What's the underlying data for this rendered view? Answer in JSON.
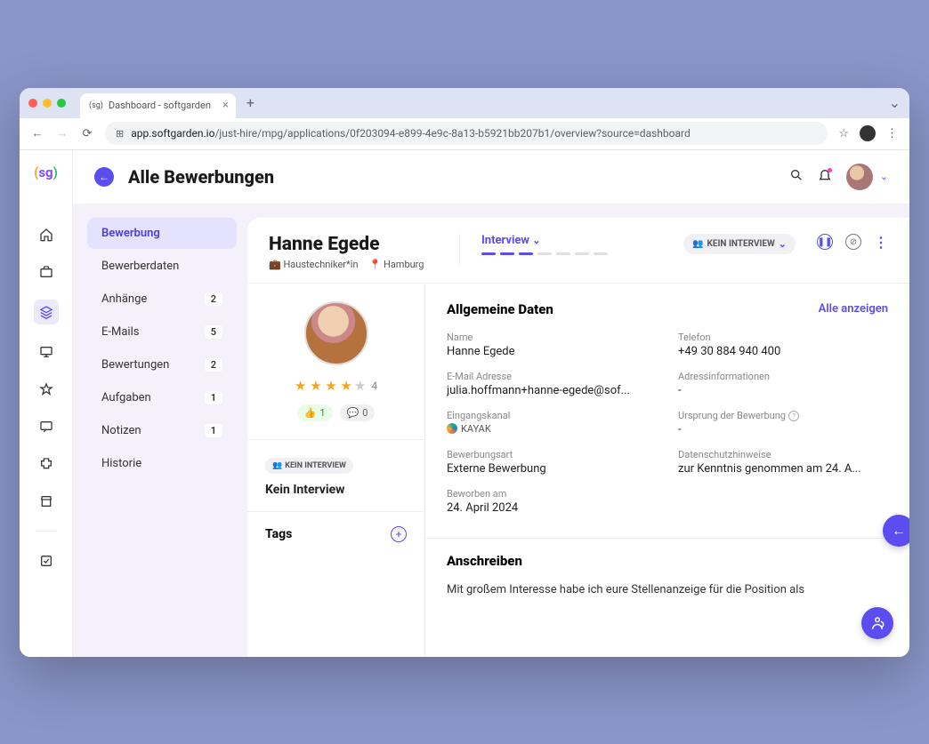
{
  "browser": {
    "tab_title": "Dashboard - softgarden",
    "url_host": "app.softgarden.io",
    "url_path": "/just-hire/mpg/applications/0f203094-e899-4e9c-8a13-b5921bb207b1/overview?source=dashboard"
  },
  "header": {
    "title": "Alle Bewerbungen"
  },
  "sidebar": {
    "items": [
      {
        "label": "Bewerbung",
        "badge": null,
        "active": true
      },
      {
        "label": "Bewerberdaten",
        "badge": null
      },
      {
        "label": "Anhänge",
        "badge": "2"
      },
      {
        "label": "E-Mails",
        "badge": "5"
      },
      {
        "label": "Bewertungen",
        "badge": "2"
      },
      {
        "label": "Aufgaben",
        "badge": "1"
      },
      {
        "label": "Notizen",
        "badge": "1"
      },
      {
        "label": "Historie",
        "badge": null
      }
    ]
  },
  "candidate": {
    "name": "Hanne Egede",
    "job": "Haustechniker*in",
    "location": "Hamburg",
    "stage_label": "Interview",
    "stage_chip": "KEIN INTERVIEW",
    "interview_chip": "KEIN INTERVIEW",
    "interview_title": "Kein Interview",
    "rating": "4",
    "thumbs_up": "1",
    "comments": "0",
    "tags_title": "Tags"
  },
  "general": {
    "section_title": "Allgemeine Daten",
    "show_all": "Alle anzeigen",
    "fields": {
      "name_label": "Name",
      "name_value": "Hanne Egede",
      "phone_label": "Telefon",
      "phone_value": "+49 30 884 940 400",
      "email_label": "E-Mail Adresse",
      "email_value": "julia.hoffmann+hanne-egede@sof...",
      "address_label": "Adressinformationen",
      "address_value": "-",
      "channel_label": "Eingangskanal",
      "channel_value": "KAYAK",
      "origin_label": "Ursprung der Bewerbung",
      "origin_value": "-",
      "type_label": "Bewerbungsart",
      "type_value": "Externe Bewerbung",
      "privacy_label": "Datenschutzhinweise",
      "privacy_value": "zur Kenntnis genommen am 24. A...",
      "applied_label": "Beworben am",
      "applied_value": "24. April 2024"
    }
  },
  "cover": {
    "title": "Anschreiben",
    "text": "Mit großem Interesse habe ich eure Stellenanzeige für die Position als"
  }
}
